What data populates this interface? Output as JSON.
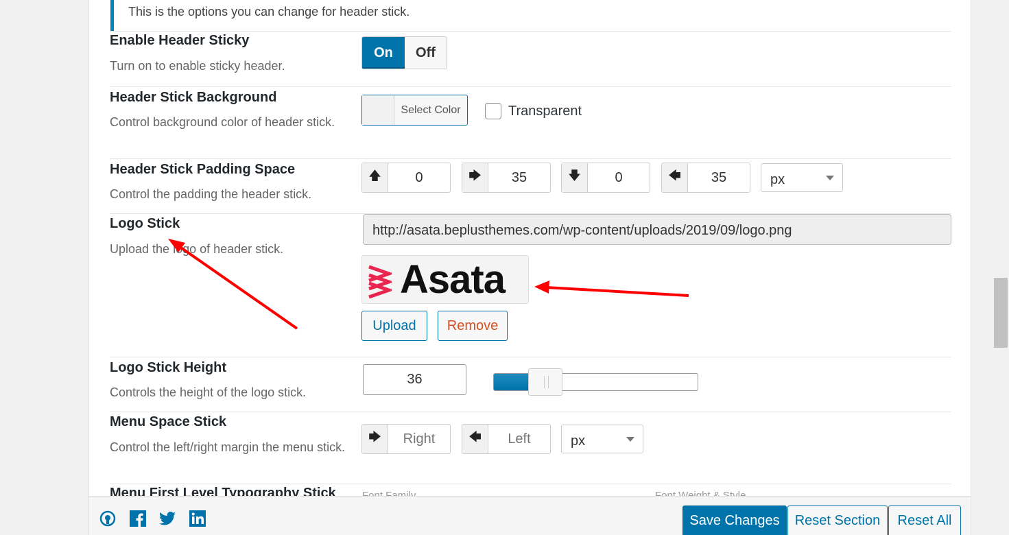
{
  "notice": {
    "text": "This is the options you can change for header stick."
  },
  "fields": {
    "sticky": {
      "title": "Enable Header Sticky",
      "desc": "Turn on to enable sticky header.",
      "on_label": "On",
      "off_label": "Off"
    },
    "background": {
      "title": "Header Stick Background",
      "desc": "Control background color of header stick.",
      "color_button": "Select Color",
      "transparent_label": "Transparent"
    },
    "padding": {
      "title": "Header Stick Padding Space",
      "desc": "Control the padding the header stick.",
      "top": "0",
      "right": "35",
      "bottom": "0",
      "left": "35",
      "unit": "px"
    },
    "logo": {
      "title": "Logo Stick",
      "desc": "Upload the logo of header stick.",
      "url": "http://asata.beplusthemes.com/wp-content/uploads/2019/09/logo.png",
      "logo_text": "Asata",
      "upload_label": "Upload",
      "remove_label": "Remove"
    },
    "logo_height": {
      "title": "Logo Stick Height",
      "desc": "Controls the height of the logo stick.",
      "value": "36",
      "slider_fraction": 0.24
    },
    "menu_space": {
      "title": "Menu Space Stick",
      "desc": "Control the left/right margin the menu stick.",
      "right_placeholder": "Right",
      "left_placeholder": "Left",
      "unit": "px"
    },
    "typography": {
      "title": "Menu First Level Typography Stick",
      "font_family_label": "Font Family",
      "font_weight_label": "Font Weight & Style"
    }
  },
  "footer": {
    "save_label": "Save Changes",
    "reset_section_label": "Reset Section",
    "reset_all_label": "Reset All"
  },
  "colors": {
    "accent": "#0073aa",
    "arrow": "#ff0000",
    "logo_brand": "#e8264f",
    "remove_text": "#d54e21"
  }
}
